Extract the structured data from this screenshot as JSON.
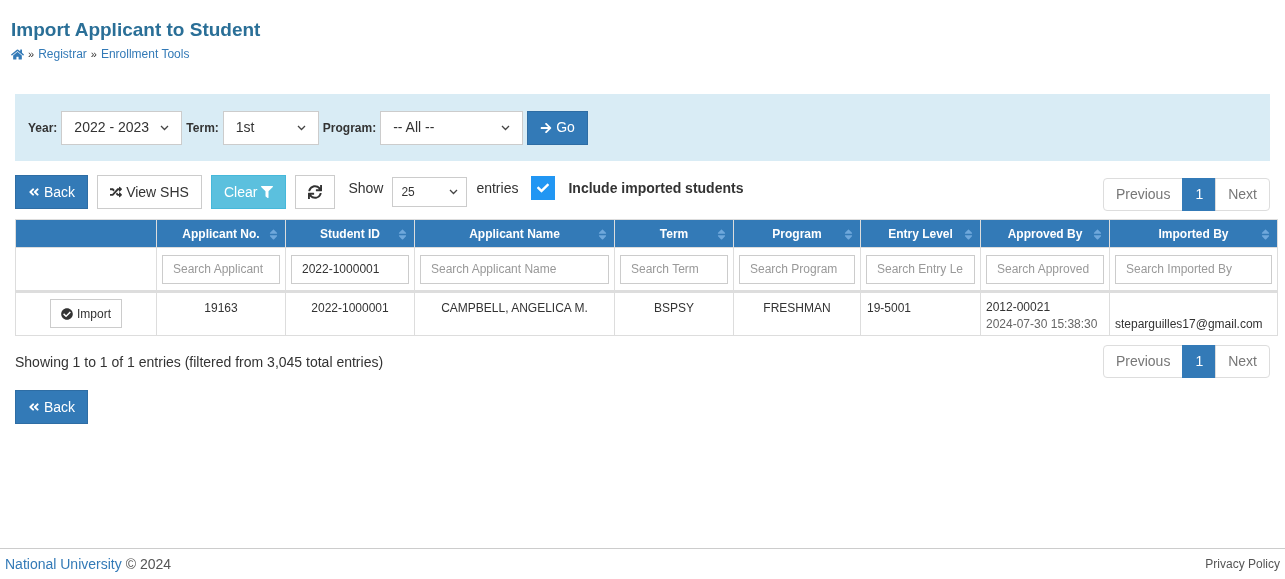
{
  "page": {
    "title": "Import Applicant to Student",
    "breadcrumbs": [
      "Registrar",
      "Enrollment Tools"
    ],
    "separator": "»"
  },
  "filters": [
    {
      "label": "Year:",
      "value": "2022 - 2023"
    },
    {
      "label": "Term:",
      "value": "1st"
    },
    {
      "label": "Program:",
      "value": "-- All --"
    }
  ],
  "go_button": "Go",
  "toolbar": {
    "back": "Back",
    "view_shs": "View SHS",
    "clear": "Clear",
    "show_label": "Show",
    "entries_value": "25",
    "entries_label": "entries",
    "include_imported": {
      "label": "Include imported students",
      "checked": true
    }
  },
  "pagination_top": [
    {
      "label": "Previous",
      "selected": false
    },
    {
      "label": "1",
      "selected": true
    },
    {
      "label": "Next",
      "selected": false
    }
  ],
  "table": {
    "columns": [
      "Applicant No.",
      "Student ID",
      "Applicant Name",
      "Term",
      "Program",
      "Entry Level",
      "Approved By",
      "Imported By"
    ],
    "search": [
      {
        "placeholder": "Search Applicant"
      },
      {
        "value": "2022-1000001"
      },
      {
        "placeholder": "Search Applicant Name"
      },
      {
        "placeholder": "Search Term"
      },
      {
        "placeholder": "Search Program"
      },
      {
        "placeholder": "Search Entry Le"
      },
      {
        "placeholder": "Search Approved"
      },
      {
        "placeholder": "Search Imported By"
      }
    ],
    "rows": [
      {
        "action": "Import",
        "applicant_no": "19163",
        "student_id": "2022-1000001",
        "name": "CAMPBELL, ANGELICA M.",
        "term": "BSPSY",
        "program": "FRESHMAN",
        "entry_level": "19-5001",
        "approved_by": "2012-00021",
        "approved_at": "2024-07-30 15:38:30",
        "imported_by": "steparguilles17@gmail.com"
      }
    ]
  },
  "info": "Showing 1 to 1 of 1 entries (filtered from 3,045 total entries)",
  "pagination_bottom": [
    {
      "label": "Previous",
      "selected": false
    },
    {
      "label": "1",
      "selected": true
    },
    {
      "label": "Next",
      "selected": false
    }
  ],
  "bottom_back": "Back",
  "footer": {
    "org": "National University",
    "copyright": "© 2024",
    "privacy": "Privacy Policy"
  }
}
